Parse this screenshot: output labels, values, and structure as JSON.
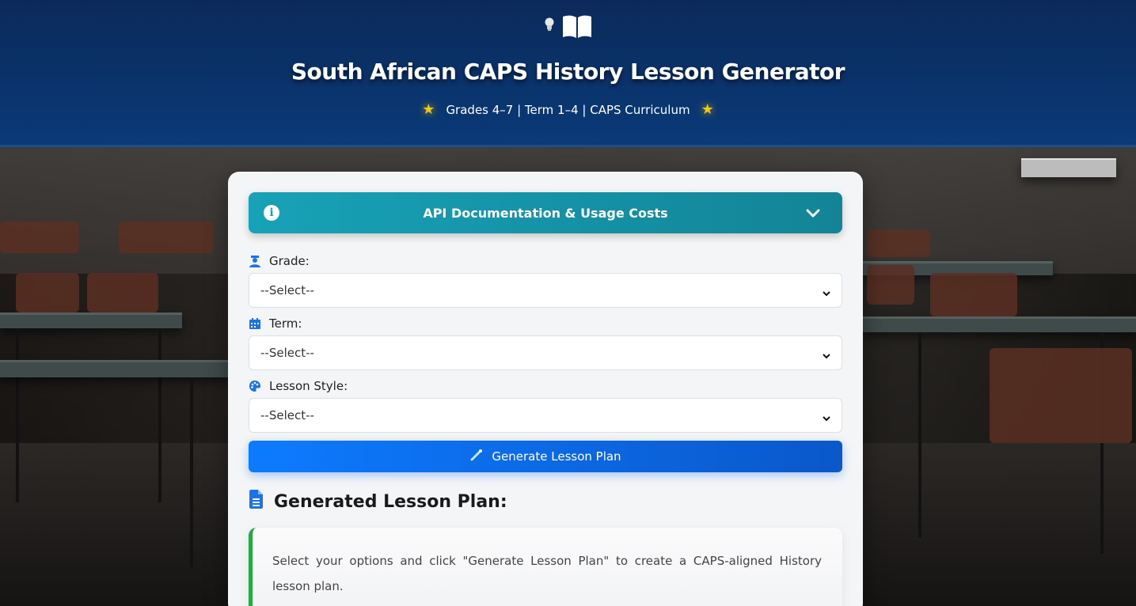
{
  "header": {
    "title": "South African CAPS History Lesson Generator",
    "subtitle": "Grades 4–7 | Term 1–4 | CAPS Curriculum",
    "icons": [
      "lightbulb-icon",
      "book-icon",
      "star-icon"
    ]
  },
  "api_docs": {
    "title": "API Documentation & Usage Costs",
    "icon": "info-icon",
    "expand_icon": "chevron-down-icon"
  },
  "form": {
    "grade": {
      "label": "Grade:",
      "value": "--Select--",
      "icon": "graduate-icon"
    },
    "term": {
      "label": "Term:",
      "value": "--Select--",
      "icon": "calendar-icon"
    },
    "style": {
      "label": "Lesson Style:",
      "value": "--Select--",
      "icon": "palette-icon"
    },
    "generate_label": "Generate Lesson Plan"
  },
  "result": {
    "heading": "Generated Lesson Plan:",
    "icon": "document-icon",
    "placeholder": "Select your options and click \"Generate Lesson Plan\" to create a CAPS-aligned History lesson plan."
  },
  "colors": {
    "header_bg": "#0a3a78",
    "api_bar": "#17a2b8",
    "primary": "#0d6efd",
    "success_border": "#28a745",
    "star": "#f6c90e"
  }
}
